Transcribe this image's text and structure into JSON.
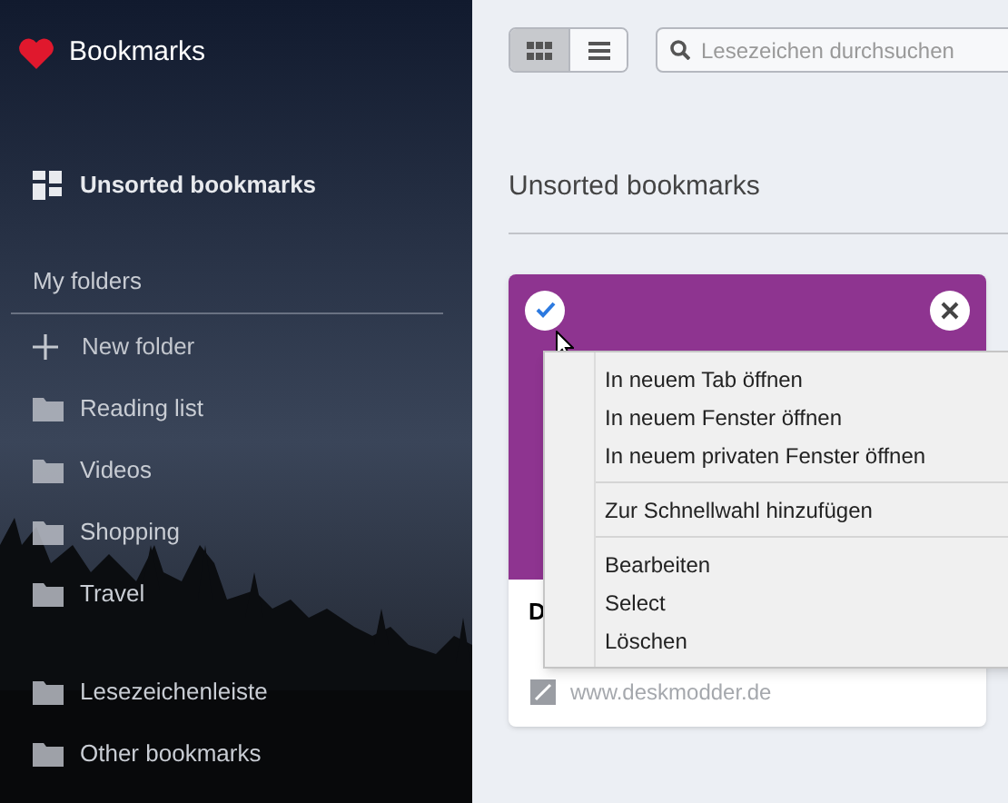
{
  "sidebar": {
    "title": "Bookmarks",
    "unsorted": {
      "label": "Unsorted bookmarks",
      "selected": true
    },
    "section_label": "My folders",
    "new_folder": "New folder",
    "folders": [
      {
        "label": "Reading list"
      },
      {
        "label": "Videos"
      },
      {
        "label": "Shopping"
      },
      {
        "label": "Travel"
      }
    ],
    "special_folders": [
      {
        "label": "Lesezeichenleiste"
      },
      {
        "label": "Other bookmarks"
      }
    ]
  },
  "toolbar": {
    "views": [
      {
        "kind": "grid",
        "selected": true
      },
      {
        "kind": "list",
        "selected": false
      }
    ],
    "search": {
      "placeholder": "Lesezeichen durchsuchen"
    }
  },
  "heading": "Unsorted bookmarks",
  "card": {
    "selected": true,
    "title": "D",
    "url": "www.deskmodder.de",
    "color": "#8e3490"
  },
  "context_menu": [
    [
      {
        "label": "In neuem Tab öffnen"
      },
      {
        "label": "In neuem Fenster öffnen"
      },
      {
        "label": "In neuem privaten Fenster öffnen"
      }
    ],
    [
      {
        "label": "Zur Schnellwahl hinzufügen"
      }
    ],
    [
      {
        "label": "Bearbeiten"
      },
      {
        "label": "Select"
      },
      {
        "label": "Löschen"
      }
    ]
  ]
}
